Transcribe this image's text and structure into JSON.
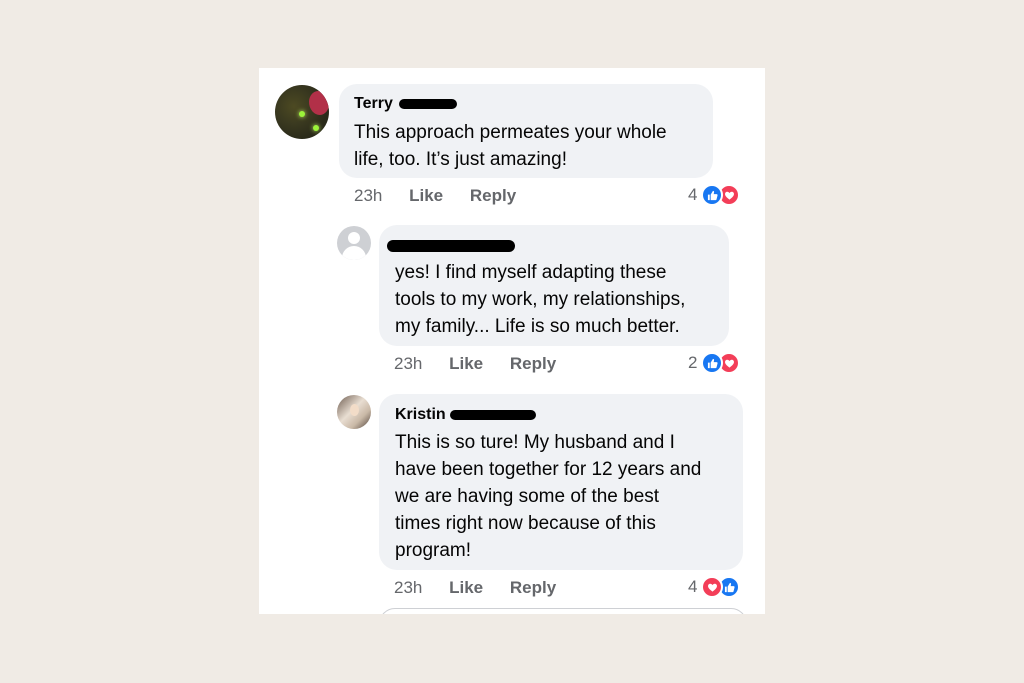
{
  "comments": [
    {
      "author": "Terry",
      "text_lines": [
        "This approach permeates your whole",
        "life, too. It’s just amazing!"
      ],
      "time": "23h",
      "like_label": "Like",
      "reply_label": "Reply",
      "reaction_count": "4",
      "reactions": [
        "like-icon",
        "love-icon"
      ]
    },
    {
      "author": "",
      "text_lines": [
        "yes!  I find myself adapting these",
        "tools to my work, my relationships,",
        "my family...  Life is so much better."
      ],
      "time": "23h",
      "like_label": "Like",
      "reply_label": "Reply",
      "reaction_count": "2",
      "reactions": [
        "like-icon",
        "love-icon"
      ]
    },
    {
      "author": "Kristin",
      "text_lines": [
        "This is so ture! My husband and I",
        "have been together for 12 years and",
        "we are having some of the best",
        "times right now because of this",
        "program!"
      ],
      "time": "23h",
      "like_label": "Like",
      "reply_label": "Reply",
      "reaction_count": "4",
      "reactions": [
        "love-icon",
        "like-icon"
      ]
    }
  ],
  "colors": {
    "page_background": "#f0ebe5",
    "bubble": "#f0f2f5",
    "like_blue": "#1877f2",
    "love_red": "#f33e58",
    "meta_gray": "#65676b"
  }
}
